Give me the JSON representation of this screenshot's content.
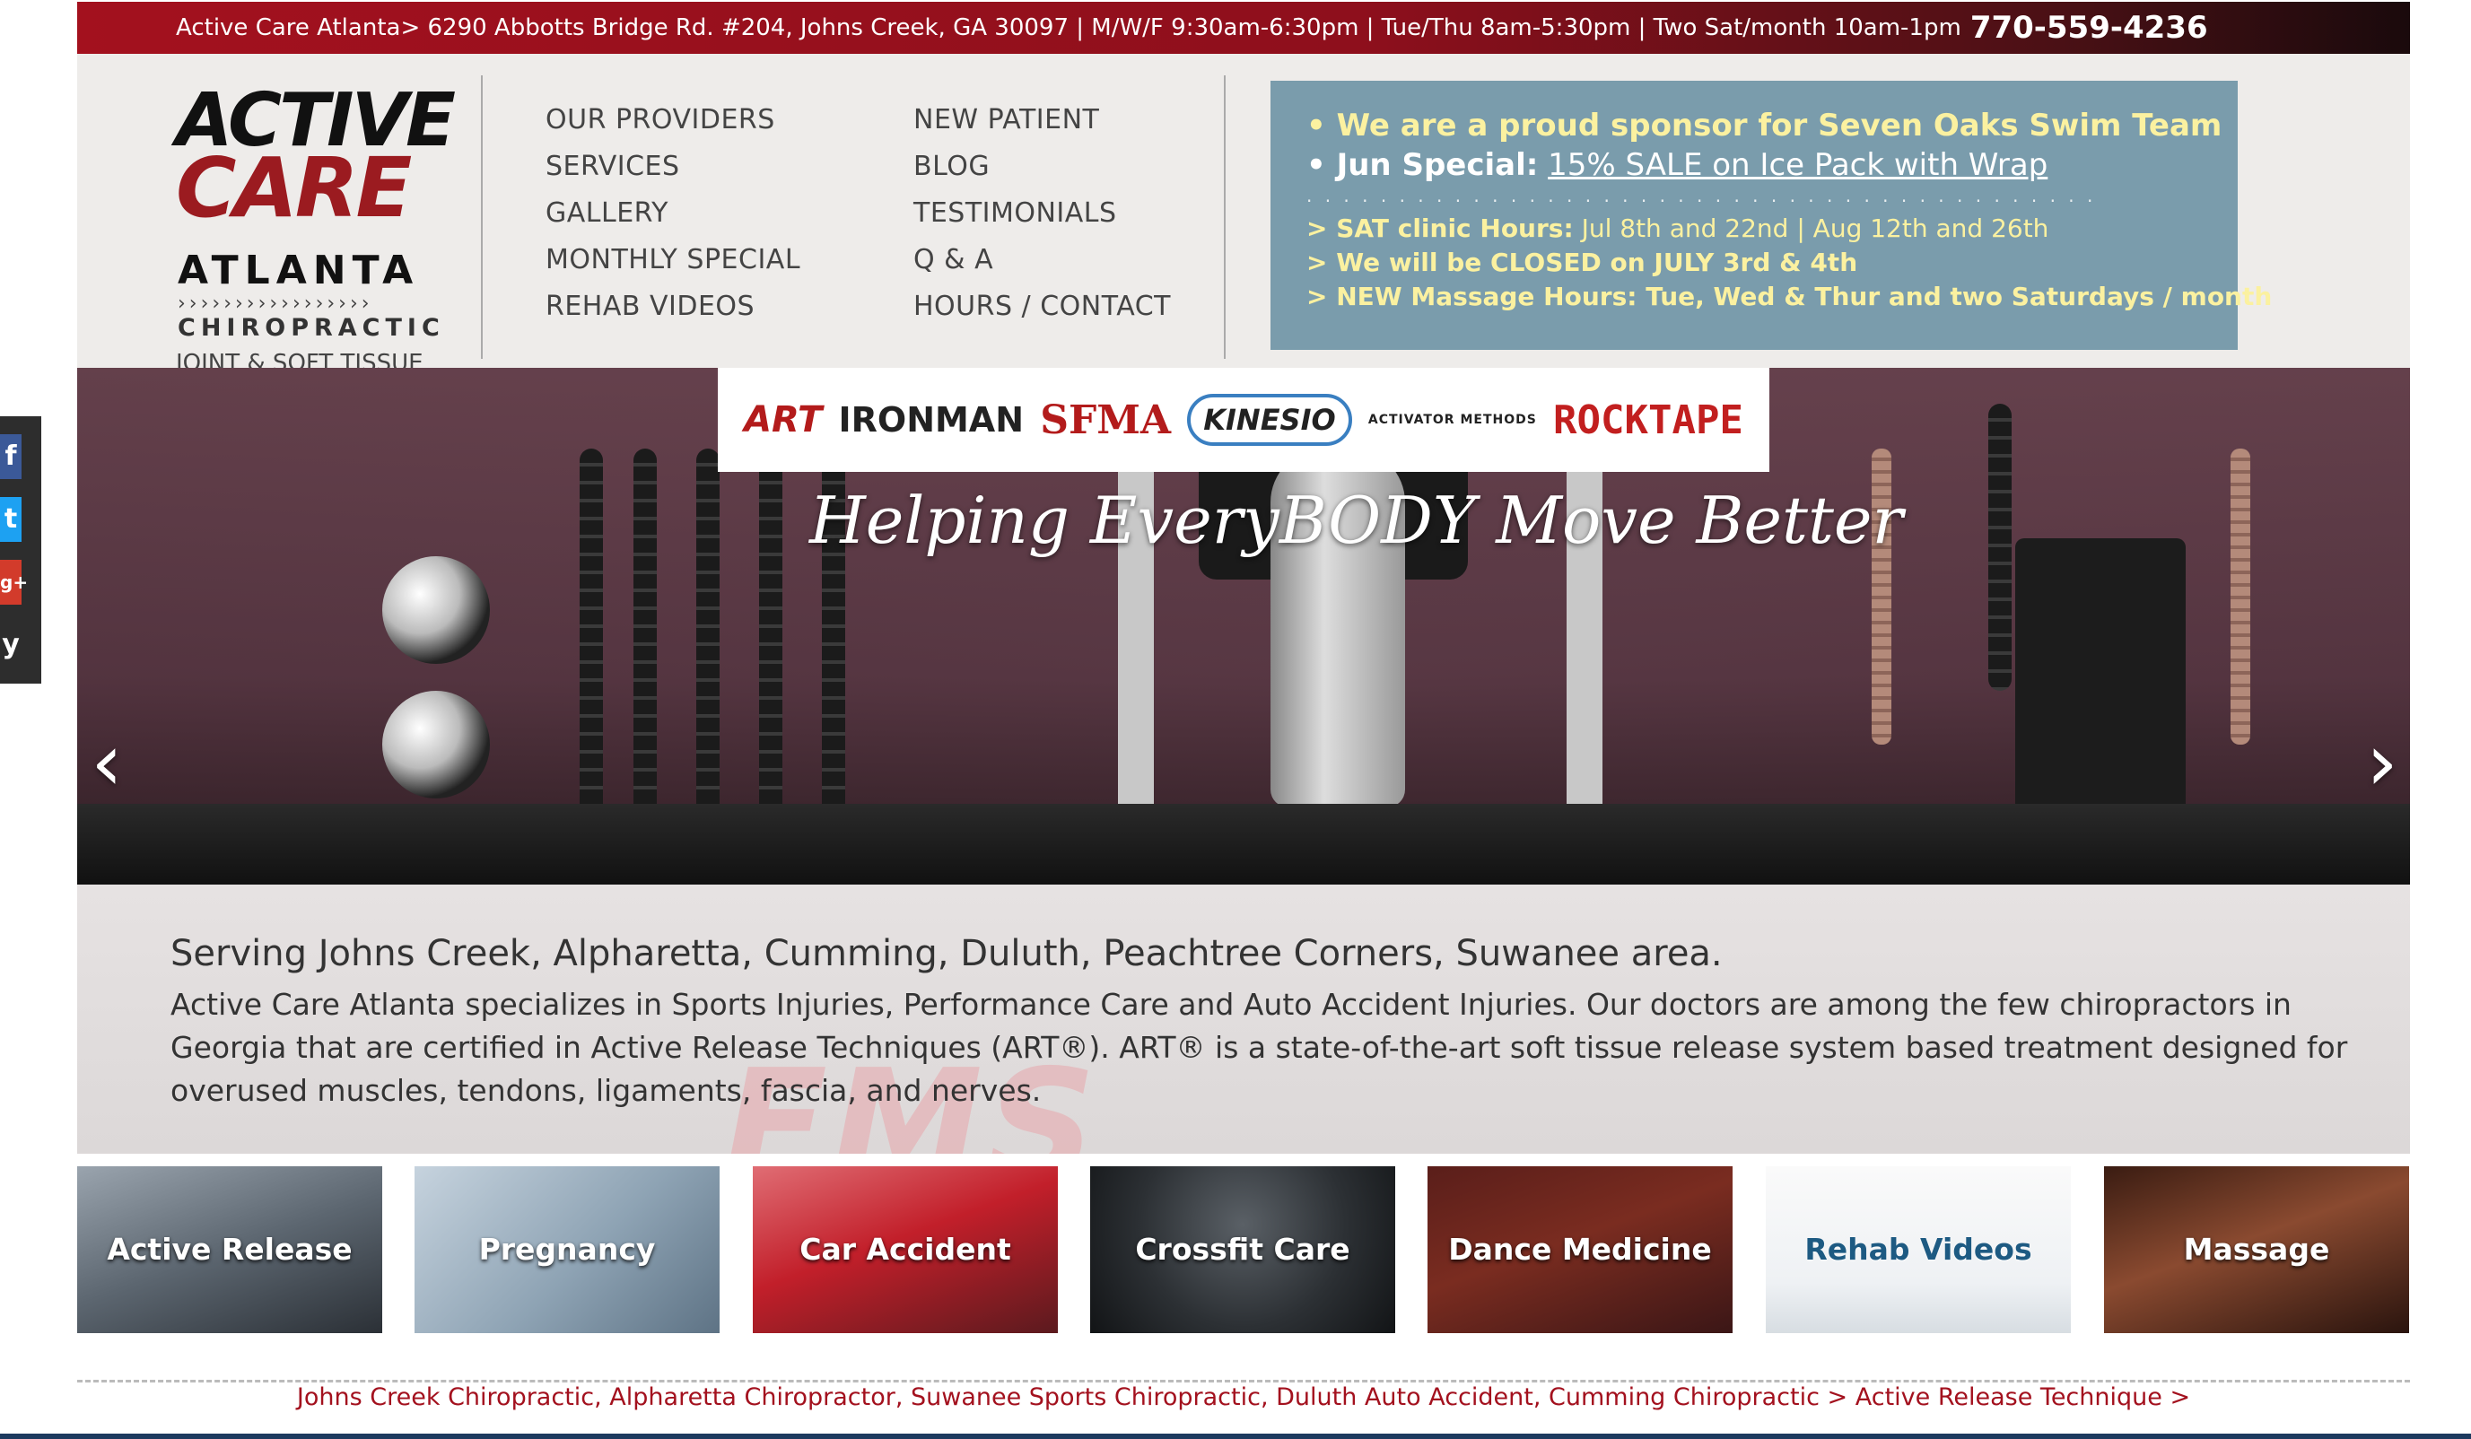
{
  "topbar": {
    "address": "Active Care Atlanta> 6290 Abbotts Bridge Rd. #204, Johns Creek, GA 30097 | M/W/F 9:30am-6:30pm | Tue/Thu 8am-5:30pm | Two Sat/month 10am-1pm",
    "phone": "770-559-4236"
  },
  "logo": {
    "line1": "ACTIVE",
    "line2": "CARE",
    "line3": "ATLANTA",
    "chevrons": "›››››››››››››››››",
    "line4": "CHIROPRACTIC",
    "line5": "JOINT & SOFT TISSUE"
  },
  "nav": {
    "col1": [
      "OUR PROVIDERS",
      "SERVICES",
      "GALLERY",
      "MONTHLY SPECIAL",
      "REHAB VIDEOS"
    ],
    "col2": [
      "NEW PATIENT",
      "BLOG",
      "TESTIMONIALS",
      "Q & A",
      "HOURS / CONTACT"
    ]
  },
  "promo": {
    "sponsor": "• We are a proud sponsor for Seven Oaks Swim Team",
    "special_label": "• Jun Special:",
    "special_link": "15% SALE on Ice Pack with Wrap",
    "dots": ". . . . . . . . . . . . . . . . . . . . . . . . . . . . . . . . . . . . . . . . . . .",
    "sat_label": "> SAT clinic Hours:",
    "sat_text": "Jul 8th and 22nd | Aug 12th and 26th",
    "closed": "> We will be CLOSED on JULY 3rd & 4th",
    "massage": "> NEW Massage Hours: Tue, Wed & Thur and two Saturdays / month"
  },
  "social": {
    "icons": [
      "facebook-icon",
      "twitter-icon",
      "google-plus-icon",
      "yelp-icon"
    ],
    "glyphs": [
      "f",
      "t",
      "g+",
      "y"
    ]
  },
  "partners": {
    "art": "ART",
    "ironman": "IRONMAN",
    "sfma": "SFMA",
    "kinesio": "KINESIO",
    "activator": "ACTIVATOR METHODS",
    "rocktape": "ROCKTAPE"
  },
  "hero": {
    "tagline": "Helping EveryBODY Move Better",
    "prev": "‹",
    "next": "›"
  },
  "intro": {
    "heading": "Serving Johns Creek, Alpharetta, Cumming, Duluth, Peachtree Corners, Suwanee area.",
    "body": "Active Care Atlanta specializes in Sports Injuries, Performance Care and Auto Accident Injuries. Our doctors are among the few chiropractors in Georgia that are certified in Active Release Techniques (ART®). ART® is a state-of-the-art soft tissue release system based treatment designed for overused muscles, tendons, ligaments, fascia, and nerves.",
    "watermark": "EMS"
  },
  "tiles": [
    {
      "label": "Active Release"
    },
    {
      "label": "Pregnancy"
    },
    {
      "label": "Car Accident"
    },
    {
      "label": "Crossfit Care"
    },
    {
      "label": "Dance Medicine"
    },
    {
      "label": "Rehab Videos"
    },
    {
      "label": "Massage"
    }
  ],
  "footer": {
    "links": "Johns Creek Chiropractic, Alpharetta Chiropractor, Suwanee Sports Chiropractic, Duluth Auto Accident, Cumming Chiropractic > Active Release Technique >"
  },
  "colors": {
    "brand_red": "#a3111e",
    "promo_bg": "#7a9cac",
    "promo_yellow": "#fbf1a0",
    "header_bg": "#eeecea"
  }
}
